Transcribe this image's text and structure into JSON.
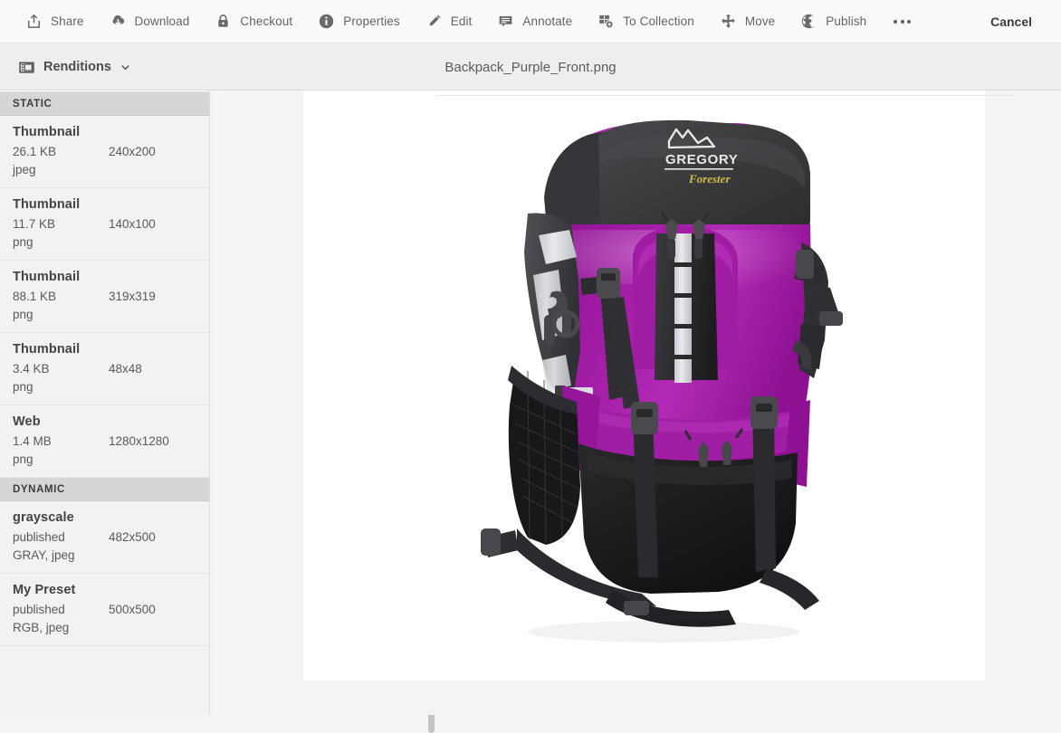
{
  "toolbar": {
    "items": [
      {
        "label": "Share",
        "icon": "share-icon"
      },
      {
        "label": "Download",
        "icon": "download-icon"
      },
      {
        "label": "Checkout",
        "icon": "lock-icon"
      },
      {
        "label": "Properties",
        "icon": "info-icon"
      },
      {
        "label": "Edit",
        "icon": "pencil-icon"
      },
      {
        "label": "Annotate",
        "icon": "comment-icon"
      },
      {
        "label": "To Collection",
        "icon": "collection-add-icon"
      },
      {
        "label": "Move",
        "icon": "move-icon"
      },
      {
        "label": "Publish",
        "icon": "globe-icon"
      }
    ],
    "more_label": "More options",
    "cancel_label": "Cancel"
  },
  "subbar": {
    "renditions_label": "Renditions",
    "chevron": "chevron-down-icon",
    "doc_title": "Backpack_Purple_Front.png"
  },
  "sidebar": {
    "partial_row": {
      "ext": "png"
    },
    "groups": [
      {
        "title": "STATIC",
        "items": [
          {
            "name": "Thumbnail",
            "size": "26.1 KB",
            "dimensions": "240x200",
            "ext": "jpeg"
          },
          {
            "name": "Thumbnail",
            "size": "11.7 KB",
            "dimensions": "140x100",
            "ext": "png"
          },
          {
            "name": "Thumbnail",
            "size": "88.1 KB",
            "dimensions": "319x319",
            "ext": "png"
          },
          {
            "name": "Thumbnail",
            "size": "3.4 KB",
            "dimensions": "48x48",
            "ext": "png"
          },
          {
            "name": "Web",
            "size": "1.4 MB",
            "dimensions": "1280x1280",
            "ext": "png"
          }
        ]
      },
      {
        "title": "DYNAMIC",
        "items": [
          {
            "name": "grayscale",
            "size": "published",
            "dimensions": "482x500",
            "ext": "GRAY, jpeg"
          },
          {
            "name": "My Preset",
            "size": "published",
            "dimensions": "500x500",
            "ext": "RGB, jpeg"
          }
        ]
      }
    ]
  },
  "asset": {
    "alt": "Purple and black hiking backpack, front view",
    "brand_logo": "GREGORY",
    "model_script": "Forester",
    "colors": {
      "purple": "#9d1aa1",
      "purple_dark": "#7d0f82",
      "purple_light": "#b730bb",
      "charcoal": "#3c3c3f",
      "charcoal_light": "#55565a",
      "black": "#1d1d20",
      "strap_grey": "#d9dade",
      "yellow": "#d9c14a"
    }
  },
  "theme": {
    "toolbar_bg": "#fafafa",
    "subbar_bg": "#eeeeee",
    "sidebar_bg": "#f2f2f2",
    "group_header_bg": "#d6d6d6",
    "canvas_bg": "#f4f4f4",
    "panel_bg": "#ffffff"
  }
}
